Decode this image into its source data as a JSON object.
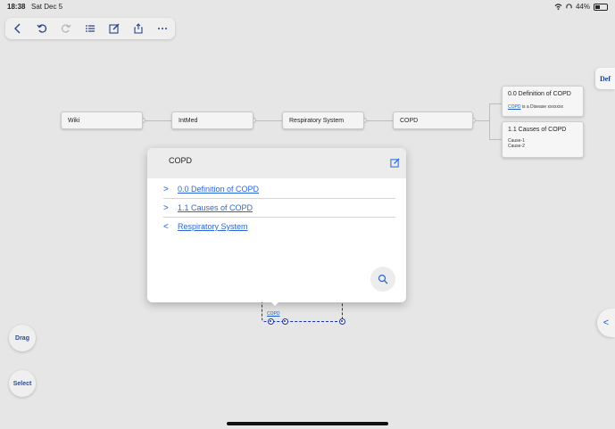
{
  "status": {
    "time": "18:38",
    "date": "Sat Dec 5",
    "battery": "44%"
  },
  "toolbar": {
    "icons": [
      "chevron-left-icon",
      "undo-icon",
      "redo-icon",
      "list-icon",
      "edit-icon",
      "share-icon",
      "more-icon"
    ]
  },
  "side": {
    "def_tab": "Def",
    "collapse_arrow": "<"
  },
  "mindmap": {
    "path": [
      "Wiki",
      "IntMed",
      "Respiratory System",
      "COPD"
    ],
    "cards": [
      {
        "title": "0.0 Definition of COPD",
        "link": "COPD",
        "body": " is a Disease xxxxxxx"
      },
      {
        "title": "1.1 Causes of COPD",
        "lines": [
          "Cause-1",
          "Cause-2"
        ]
      }
    ],
    "selected_label": "COPD"
  },
  "popover": {
    "title": "COPD",
    "items": [
      {
        "chevron": ">",
        "label": "0.0 Definition of COPD"
      },
      {
        "chevron": ">",
        "label": "1.1 Causes of COPD"
      },
      {
        "chevron": "<",
        "label": "Respiratory System"
      }
    ]
  },
  "buttons": {
    "drag": "Drag",
    "select": "Select"
  },
  "colors": {
    "accent": "#2a66d9",
    "selection": "#1a2fb0"
  }
}
